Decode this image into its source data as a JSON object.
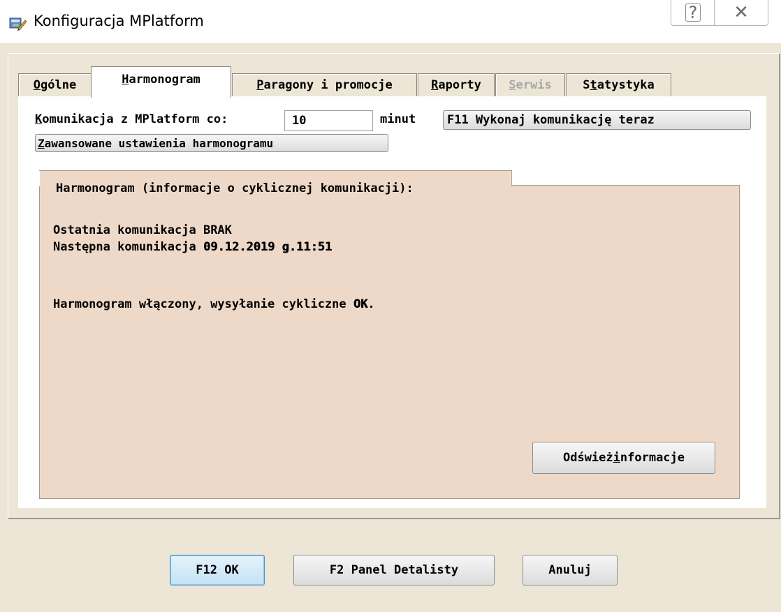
{
  "window": {
    "title": "Konfiguracja MPlatform",
    "help_glyph": "?",
    "close_glyph": "✕"
  },
  "tabs": [
    {
      "label": "Ogólne",
      "underline": "O",
      "rest": "gólne",
      "active": false,
      "disabled": false
    },
    {
      "label": "Harmonogram",
      "underline": "H",
      "rest": "armonogram",
      "active": true,
      "disabled": false
    },
    {
      "label": "Paragony i promocje",
      "underline": "P",
      "rest": "aragony i promocje",
      "active": false,
      "disabled": false
    },
    {
      "label": "Raporty",
      "underline": "R",
      "rest": "aporty",
      "active": false,
      "disabled": false
    },
    {
      "label": "Serwis",
      "underline": "S",
      "rest": "erwis",
      "active": false,
      "disabled": true
    },
    {
      "label": "Statystyka",
      "pre": "S",
      "underline": "t",
      "rest": "atystyka",
      "active": false,
      "disabled": false
    }
  ],
  "harmonogram": {
    "interval_label_u": "K",
    "interval_label_rest": "omunikacja z MPlatform co:",
    "interval_value": "10",
    "interval_unit": "minut",
    "execute_now_button": "F11 Wykonaj komunikację teraz",
    "advanced_button_u": "Z",
    "advanced_button_rest": "awansowane ustawienia harmonogramu",
    "group_title": "Harmonogram (informacje o cyklicznej komunikacji):",
    "last_comm_label": "Ostatnia komunikacja",
    "last_comm_value": "BRAK",
    "next_comm_label": "Następna komunikacja",
    "next_comm_value": "09.12.2019 g.11:51",
    "status_prefix": "Harmonogram włączony, wysyłanie cykliczne",
    "status_value": "OK",
    "status_suffix": ".",
    "refresh_button_pre": "Odśwież ",
    "refresh_button_u": "i",
    "refresh_button_rest": "nformacje"
  },
  "footer": {
    "ok_button": "F12 OK",
    "panel_button": "F2 Panel Detalisty",
    "cancel_button": "Anuluj"
  },
  "colors": {
    "window_bg": "#ede6d6",
    "group_bg": "#eed9c8",
    "ok_accent": "#c3e2f6",
    "disabled_text": "#a8a8a8"
  },
  "icons": {
    "app_icon": "settings-app-icon",
    "help_icon": "help-icon",
    "close_icon": "close-icon"
  }
}
